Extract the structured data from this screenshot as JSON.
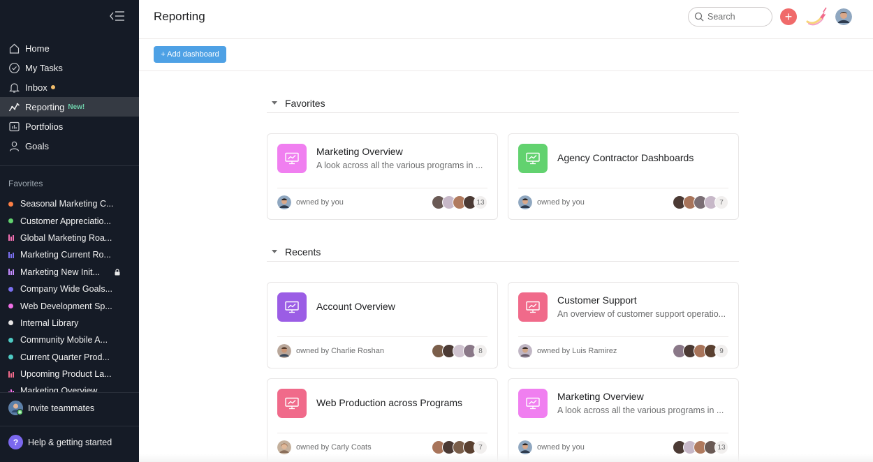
{
  "sidebar": {
    "nav": [
      {
        "label": "Home",
        "icon": "home-icon"
      },
      {
        "label": "My Tasks",
        "icon": "check-circle-icon"
      },
      {
        "label": "Inbox",
        "icon": "bell-icon",
        "dot_color": "#f1bd6c"
      },
      {
        "label": "Reporting",
        "icon": "reporting-icon",
        "badge": "New!",
        "active": true
      },
      {
        "label": "Portfolios",
        "icon": "portfolio-icon"
      },
      {
        "label": "Goals",
        "icon": "goals-icon"
      }
    ],
    "favorites_header": "Favorites",
    "favorites": [
      {
        "label": "Seasonal Marketing C...",
        "marker": "dot",
        "color": "#fd7f45"
      },
      {
        "label": "Customer Appreciatio...",
        "marker": "dot",
        "color": "#62d26f"
      },
      {
        "label": "Global Marketing Roa...",
        "marker": "bars",
        "color": "#f26fb2"
      },
      {
        "label": "Marketing Current Ro...",
        "marker": "bars",
        "color": "#7a6ff0"
      },
      {
        "label": "Marketing New Init...",
        "marker": "bars",
        "color": "#c38bff",
        "locked": true
      },
      {
        "label": "Company Wide Goals...",
        "marker": "dot",
        "color": "#7a6ff0"
      },
      {
        "label": "Web Development Sp...",
        "marker": "dot",
        "color": "#f06fe6"
      },
      {
        "label": "Internal Library",
        "marker": "dot",
        "color": "#e8e6e6"
      },
      {
        "label": "Community Mobile A...",
        "marker": "dot",
        "color": "#4ecbc4"
      },
      {
        "label": "Current Quarter Prod...",
        "marker": "dot",
        "color": "#4ecbc4"
      },
      {
        "label": "Upcoming Product La...",
        "marker": "bars",
        "color": "#f06a8a"
      },
      {
        "label": "Marketing Overview",
        "marker": "bars",
        "color": "#f06fe6"
      }
    ],
    "invite_label": "Invite teammates",
    "help_label": "Help & getting started",
    "help_glyph": "?"
  },
  "header": {
    "title": "Reporting",
    "search_placeholder": "Search",
    "add_glyph": "+"
  },
  "toolbar": {
    "add_dashboard_label": "+ Add dashboard"
  },
  "sections": {
    "favorites": {
      "title": "Favorites",
      "cards": [
        {
          "title": "Marketing Overview",
          "description": "A look across all the various programs in ...",
          "icon_color": "#f07ff0",
          "owner": "owned by you",
          "member_avatar_count": 4,
          "member_count": "13"
        },
        {
          "title": "Agency Contractor Dashboards",
          "description": "",
          "icon_color": "#62d26f",
          "owner": "owned by you",
          "member_avatar_count": 4,
          "member_count": "7"
        }
      ]
    },
    "recents": {
      "title": "Recents",
      "cards": [
        {
          "title": "Account Overview",
          "description": "",
          "icon_color": "#9b5de5",
          "owner": "owned by Charlie Roshan",
          "member_avatar_count": 4,
          "member_count": "8"
        },
        {
          "title": "Customer Support",
          "description": "An overview of customer support operatio...",
          "icon_color": "#f06a8a",
          "owner": "owned by Luis Ramirez",
          "member_avatar_count": 4,
          "member_count": "9"
        },
        {
          "title": "Web Production across Programs",
          "description": "",
          "icon_color": "#f06a8a",
          "owner": "owned by Carly Coats",
          "member_avatar_count": 4,
          "member_count": "7"
        },
        {
          "title": "Marketing Overview",
          "description": "A look across all the various programs in ...",
          "icon_color": "#f07ff0",
          "owner": "owned by you",
          "member_avatar_count": 4,
          "member_count": "13"
        }
      ]
    }
  }
}
